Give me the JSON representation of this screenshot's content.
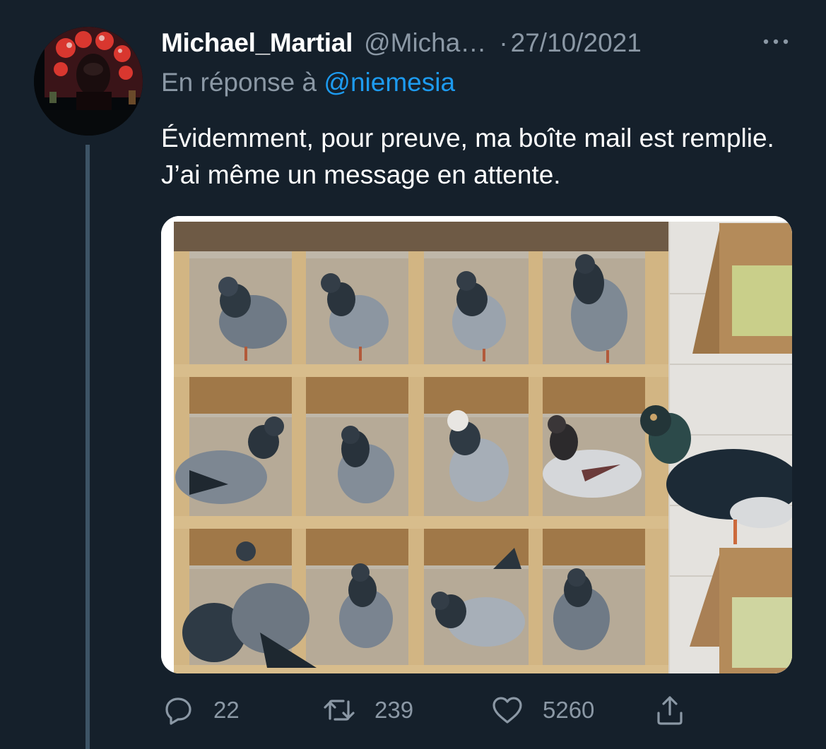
{
  "tweet": {
    "author_name": "Michael_Martial",
    "author_handle": "@Micha…",
    "separator": "·",
    "date": "27/10/2021",
    "reply_prefix": "En réponse à",
    "reply_to": "@niemesia",
    "text": "Évidemment, pour preuve, ma boîte mail est remplie. J’ai même un message en attente.",
    "media_description_icon": "pigeons-in-pigeonholes-photo"
  },
  "actions": {
    "reply_count": "22",
    "retweet_count": "239",
    "like_count": "5260",
    "share_icon": "share-icon"
  },
  "colors": {
    "background": "#15202b",
    "text_primary": "#ffffff",
    "text_secondary": "#8b98a5",
    "accent": "#1d9bf0",
    "thread_line": "#3d5466"
  }
}
